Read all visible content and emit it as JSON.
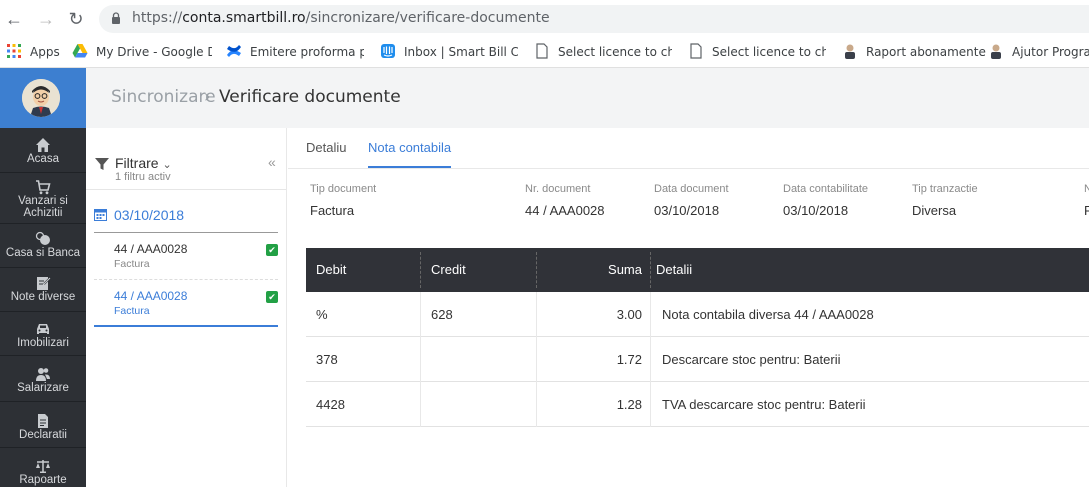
{
  "browser": {
    "url_prefix": "https://",
    "url_host": "conta.smartbill.ro",
    "url_path": "/sincronizare/verificare-documente",
    "bookmarks": [
      {
        "label": "Apps",
        "icon": "apps-grid-icon"
      },
      {
        "label": "My Drive - Google Dr",
        "icon": "google-drive-icon"
      },
      {
        "label": "Emitere proforma pe",
        "icon": "confluence-icon"
      },
      {
        "label": "Inbox | Smart Bill Co",
        "icon": "intercom-icon"
      },
      {
        "label": "Select licence to char",
        "icon": "page-icon"
      },
      {
        "label": "Select licence to char",
        "icon": "page-icon"
      },
      {
        "label": "Raport abonamente",
        "icon": "avatar-icon"
      },
      {
        "label": "Ajutor Program",
        "icon": "avatar-icon"
      }
    ]
  },
  "sidebar": {
    "items": [
      {
        "label": "Acasa",
        "icon": "home-icon"
      },
      {
        "label": "Vanzari si Achizitii",
        "icon": "cart-icon"
      },
      {
        "label": "Casa si Banca",
        "icon": "coins-icon"
      },
      {
        "label": "Note diverse",
        "icon": "notes-icon"
      },
      {
        "label": "Imobilizari",
        "icon": "car-icon"
      },
      {
        "label": "Salarizare",
        "icon": "users-icon"
      },
      {
        "label": "Declaratii",
        "icon": "document-icon"
      },
      {
        "label": "Rapoarte",
        "icon": "scale-icon"
      }
    ]
  },
  "header": {
    "breadcrumb_parent": "Sincronizare",
    "breadcrumb_current": "Verificare documente"
  },
  "filter": {
    "label": "Filtrare",
    "sublabel": "1 filtru activ"
  },
  "documents": {
    "date": "03/10/2018",
    "items": [
      {
        "number": "44 / AAA0028",
        "type": "Factura",
        "checked": true,
        "active": false
      },
      {
        "number": "44 / AAA0028",
        "type": "Factura",
        "checked": true,
        "active": true
      }
    ]
  },
  "tabs": [
    {
      "label": "Detaliu",
      "active": false
    },
    {
      "label": "Nota contabila",
      "active": true
    }
  ],
  "fields": [
    {
      "label": "Tip document",
      "value": "Factura"
    },
    {
      "label": "Nr. document",
      "value": "44 / AAA0028"
    },
    {
      "label": "Data document",
      "value": "03/10/2018"
    },
    {
      "label": "Data contabilitate",
      "value": "03/10/2018"
    },
    {
      "label": "Tip tranzactie",
      "value": "Diversa"
    },
    {
      "label": "N",
      "value": "R"
    }
  ],
  "table": {
    "columns": [
      "Debit",
      "Credit",
      "Suma",
      "Detalii"
    ],
    "rows": [
      {
        "debit": "%",
        "credit": "628",
        "suma": "3.00",
        "detalii": "Nota contabila diversa 44 / AAA0028"
      },
      {
        "debit": "378",
        "credit": "",
        "suma": "1.72",
        "detalii": "Descarcare stoc pentru: Baterii"
      },
      {
        "debit": "4428",
        "credit": "",
        "suma": "1.28",
        "detalii": "TVA descarcare stoc pentru: Baterii"
      }
    ]
  },
  "colors": {
    "accent": "#3b7dd8",
    "sidebar_bg": "#2d3035",
    "table_header_bg": "#303238",
    "check_green": "#22a045"
  }
}
